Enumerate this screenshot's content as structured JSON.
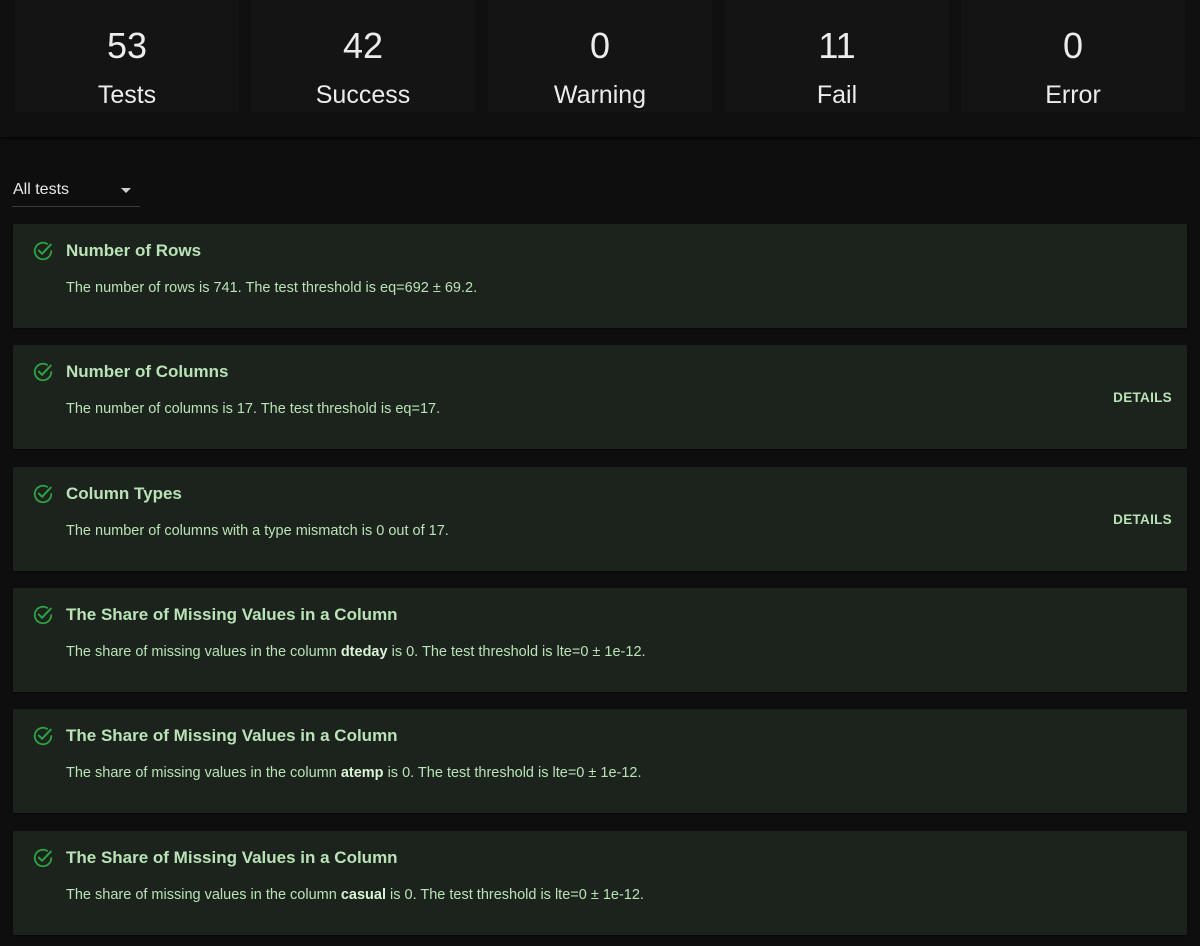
{
  "summary": {
    "tests": {
      "value": "53",
      "label": "Tests"
    },
    "success": {
      "value": "42",
      "label": "Success"
    },
    "warning": {
      "value": "0",
      "label": "Warning"
    },
    "fail": {
      "value": "11",
      "label": "Fail"
    },
    "error": {
      "value": "0",
      "label": "Error"
    }
  },
  "filter": {
    "selected": "All tests"
  },
  "details_label": "DETAILS",
  "icon": "check-circle-icon",
  "colors": {
    "success_green": "#2ea043",
    "card_bg": "#1c221c",
    "text_green": "#b9e3b7"
  },
  "tests": [
    {
      "title": "Number of Rows",
      "desc_before": "The number of rows is 741. The test threshold is eq=692 ± 69.2.",
      "desc_bold": "",
      "desc_after": ""
    },
    {
      "title": "Number of Columns",
      "desc_before": "The number of columns is 17. The test threshold is eq=17.",
      "desc_bold": "",
      "desc_after": ""
    },
    {
      "title": "Column Types",
      "desc_before": "The number of columns with a type mismatch is 0 out of 17.",
      "desc_bold": "",
      "desc_after": ""
    },
    {
      "title": "The Share of Missing Values in a Column",
      "desc_before": "The share of missing values in the column ",
      "desc_bold": "dteday",
      "desc_after": " is 0. The test threshold is lte=0 ± 1e-12."
    },
    {
      "title": "The Share of Missing Values in a Column",
      "desc_before": "The share of missing values in the column ",
      "desc_bold": "atemp",
      "desc_after": " is 0. The test threshold is lte=0 ± 1e-12."
    },
    {
      "title": "The Share of Missing Values in a Column",
      "desc_before": "The share of missing values in the column ",
      "desc_bold": "casual",
      "desc_after": " is 0. The test threshold is lte=0 ± 1e-12."
    }
  ]
}
